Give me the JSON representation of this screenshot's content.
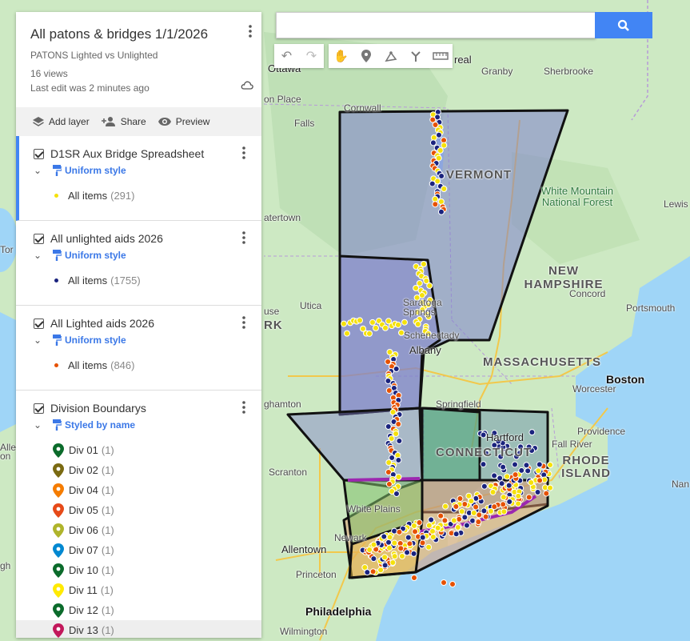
{
  "panel": {
    "title": "All patons & bridges 1/1/2026",
    "description": "PATONS Lighted vs Unlighted",
    "views": "16 views",
    "last_edit": "Last edit was 2 minutes ago",
    "actions": {
      "add_layer": "Add layer",
      "share": "Share",
      "preview": "Preview"
    },
    "layers": [
      {
        "name": "D1SR Aux Bridge Spreadsheet",
        "style": "Uniform style",
        "item_label": "All items",
        "count": "(291)",
        "color": "#f5e10b"
      },
      {
        "name": "All unlighted aids 2026",
        "style": "Uniform style",
        "item_label": "All items",
        "count": "(1755)",
        "color": "#1a237e"
      },
      {
        "name": "All Lighted aids 2026",
        "style": "Uniform style",
        "item_label": "All items",
        "count": "(846)",
        "color": "#e65100"
      }
    ],
    "boundaries": {
      "name": "Division Boundarys",
      "style": "Styled by name",
      "divisions": [
        {
          "label": "Div 01",
          "count": "(1)",
          "color": "#0b6b2b"
        },
        {
          "label": "Div 02",
          "count": "(1)",
          "color": "#7a6a12"
        },
        {
          "label": "Div 04",
          "count": "(1)",
          "color": "#f57c00"
        },
        {
          "label": "Div 05",
          "count": "(1)",
          "color": "#e64a19"
        },
        {
          "label": "Div 06",
          "count": "(1)",
          "color": "#afb42b"
        },
        {
          "label": "Div 07",
          "count": "(1)",
          "color": "#0288d1"
        },
        {
          "label": "Div 10",
          "count": "(1)",
          "color": "#0b6b2b"
        },
        {
          "label": "Div 11",
          "count": "(1)",
          "color": "#ffea00"
        },
        {
          "label": "Div 12",
          "count": "(1)",
          "color": "#0b6b2b"
        },
        {
          "label": "Div 13",
          "count": "(1)",
          "color": "#c2185b"
        }
      ]
    }
  },
  "map_labels": {
    "ottawa": "Ottawa",
    "montreal": "real",
    "granby": "Granby",
    "sherbrooke": "Sherbrooke",
    "cornwall": "Cornwall",
    "vermont": "VERMONT",
    "white_mountain": "White Mountain National Forest",
    "lewis": "Lewis",
    "watertown": "atertown",
    "new_hampshire": "NEW HAMPSHIRE",
    "concord": "Concord",
    "portsmouth": "Portsmouth",
    "saratoga": "Saratoga Springs",
    "utica": "Utica",
    "schenectady": "Schenectady",
    "albany": "Albany",
    "massachusetts": "MASSACHUSETTS",
    "boston": "Boston",
    "worcester": "Worcester",
    "springfield": "Springfield",
    "hartford": "Hartford",
    "connecticut": "CONNECTICUT",
    "providence": "Providence",
    "fall_river": "Fall River",
    "rhode_island": "RHODE ISLAND",
    "binghamton": "ghamton",
    "scranton": "Scranton",
    "white_plains": "White Plains",
    "newark": "Newark",
    "allentown": "Allentown",
    "princeton": "Princeton",
    "philadelphia": "Philadelphia",
    "wilmington": "Wilmington",
    "nan": "Nan",
    "place": "on Place",
    "falls": "Falls",
    "rk": "RK",
    "use": "use",
    "tor": "Tor",
    "alle": "Alle",
    "gh": "gh",
    "on": "on"
  }
}
